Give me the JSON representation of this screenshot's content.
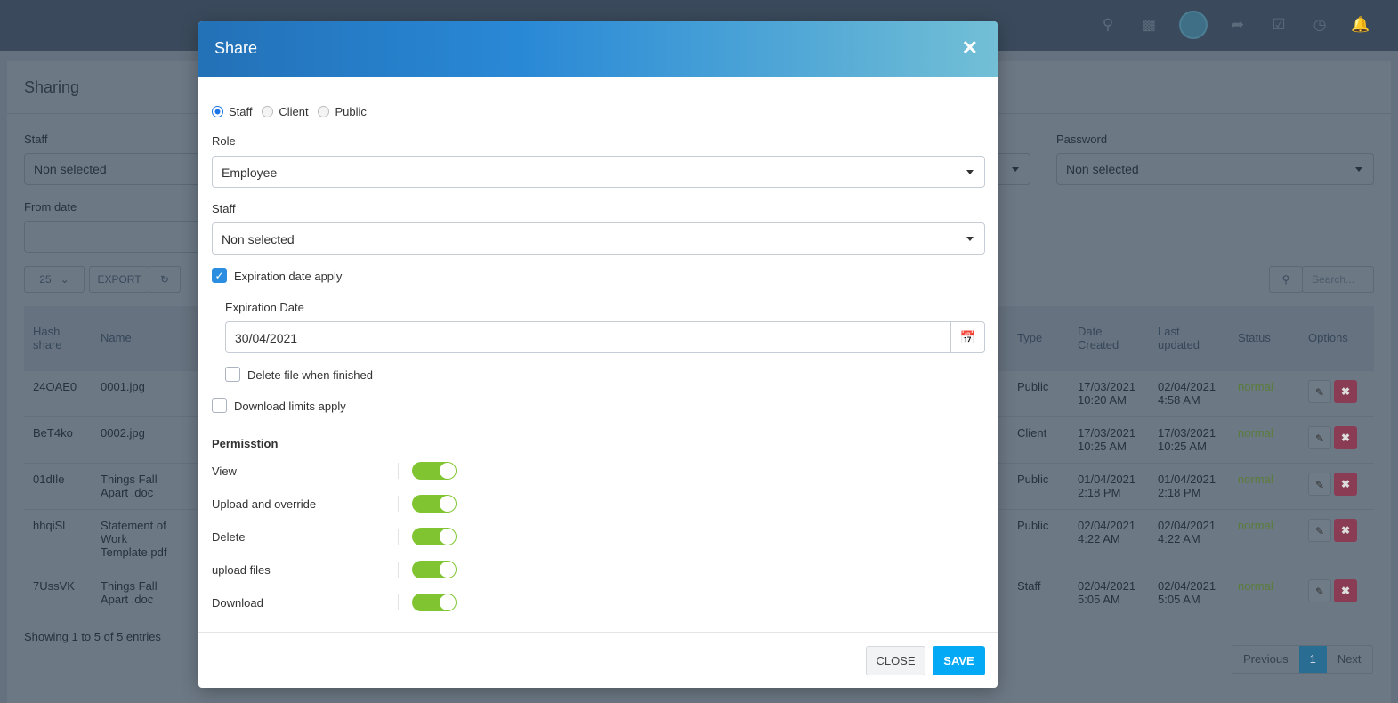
{
  "topbar": {
    "icons": [
      "search-icon",
      "contact-card-icon",
      "avatar",
      "share-icon",
      "checkbox-icon",
      "clock-icon",
      "bell-icon"
    ]
  },
  "page": {
    "title": "Sharing",
    "filters": {
      "staff_label": "Staff",
      "staff_value": "Non selected",
      "password_label": "Password",
      "password_value": "Non selected",
      "from_date_label": "From date"
    },
    "page_size": "25",
    "export": "EXPORT",
    "search_placeholder": "Search...",
    "columns_left": [
      "Hash share",
      "Name"
    ],
    "columns_right": [
      "Type",
      "Date Created",
      "Last updated",
      "Status",
      "Options"
    ],
    "rows": [
      {
        "hash": "24OAE0",
        "name": "0001.jpg",
        "type": "Public",
        "created": "17/03/2021 10:20 AM",
        "updated": "02/04/2021 4:58 AM",
        "status": "normal"
      },
      {
        "hash": "BeT4ko",
        "name": "0002.jpg",
        "type": "Client",
        "created": "17/03/2021 10:25 AM",
        "updated": "17/03/2021 10:25 AM",
        "status": "normal"
      },
      {
        "hash": "01dIle",
        "name": "Things Fall Apart .doc",
        "type": "Public",
        "created": "01/04/2021 2:18 PM",
        "updated": "01/04/2021 2:18 PM",
        "status": "normal"
      },
      {
        "hash": "hhqiSl",
        "name": "Statement of Work Template.pdf",
        "type": "Public",
        "created": "02/04/2021 4:22 AM",
        "updated": "02/04/2021 4:22 AM",
        "status": "normal"
      },
      {
        "hash": "7UssVK",
        "name": "Things Fall Apart .doc",
        "type": "Staff",
        "created": "02/04/2021 5:05 AM",
        "updated": "02/04/2021 5:05 AM",
        "status": "normal"
      }
    ],
    "info": "Showing 1 to 5 of 5 entries",
    "pagination": {
      "prev": "Previous",
      "current": "1",
      "next": "Next"
    }
  },
  "modal": {
    "title": "Share",
    "share_to": {
      "options": [
        "Staff",
        "Client",
        "Public"
      ],
      "selected": "Staff"
    },
    "role_label": "Role",
    "role_value": "Employee",
    "staff_label": "Staff",
    "staff_value": "Non selected",
    "expiration_apply": {
      "label": "Expiration date apply",
      "checked": true
    },
    "expiration_date_label": "Expiration Date",
    "expiration_date": "30/04/2021",
    "delete_when_finished": {
      "label": "Delete file when finished",
      "checked": false
    },
    "download_limits": {
      "label": "Download limits apply",
      "checked": false
    },
    "permission_title": "Permisstion",
    "permissions": [
      {
        "label": "View",
        "on": true
      },
      {
        "label": "Upload and override",
        "on": true
      },
      {
        "label": "Delete",
        "on": true
      },
      {
        "label": "upload files",
        "on": true
      },
      {
        "label": "Download",
        "on": true
      }
    ],
    "close": "CLOSE",
    "save": "SAVE"
  }
}
